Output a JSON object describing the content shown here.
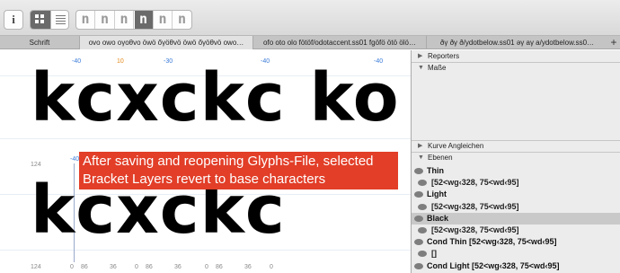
{
  "toolbar": {
    "info_label": "i",
    "glyph_tabs": [
      "n",
      "n",
      "n",
      "n",
      "n",
      "n"
    ]
  },
  "tabs": [
    {
      "label": "Schrift"
    },
    {
      "label": "ovo owo oγoθvo öwö őγöθvö öwö őγöθvö owo…"
    },
    {
      "label": "ofo oto olo fötöf/odotaccent.ss01 fgöfö ötö ölö…"
    },
    {
      "label": "ðγ ðγ ð/ydotbelow.ss01 əγ aγ a/ydotbelow.ss0…"
    }
  ],
  "tab_add": "+",
  "canvas": {
    "line1_text": "kcxckc ko",
    "line2_text": "kcxckc",
    "kerning": [
      "-40",
      "10",
      "-30",
      "-40",
      "-40"
    ],
    "left_number_1": "124",
    "left_number_2": "124",
    "left_number_3": "-40",
    "bottom_coords": [
      "124",
      "0",
      "86",
      "36",
      "0",
      "86",
      "36",
      "0",
      "86",
      "36",
      "0"
    ],
    "note_line1": "After saving and reopening Glyphs-File, selected",
    "note_line2": "Bracket Layers revert to base characters"
  },
  "panel": {
    "reporters": "Reporters",
    "masse": "Maße",
    "kurve": "Kurve Angleichen",
    "ebenen": "Ebenen",
    "layers": [
      {
        "name": "Thin",
        "type": "master"
      },
      {
        "name": "[52<wg‹328, 75<wd‹95]",
        "type": "sub"
      },
      {
        "name": "Light",
        "type": "master"
      },
      {
        "name": "[52<wg‹328, 75<wd‹95]",
        "type": "sub"
      },
      {
        "name": "Black",
        "type": "master",
        "selected": true
      },
      {
        "name": "[52<wg‹328, 75<wd‹95]",
        "type": "sub"
      },
      {
        "name": "Cond Thin [52<wg‹328, 75<wd‹95]",
        "type": "master"
      },
      {
        "name": "[]",
        "type": "sub"
      },
      {
        "name": "Cond Light [52<wg‹328, 75<wd‹95]",
        "type": "master"
      }
    ]
  },
  "colors": {
    "note_bg": "#e23e28",
    "kern_blue": "#3a7ad8",
    "kern_orange": "#e58a1c"
  }
}
